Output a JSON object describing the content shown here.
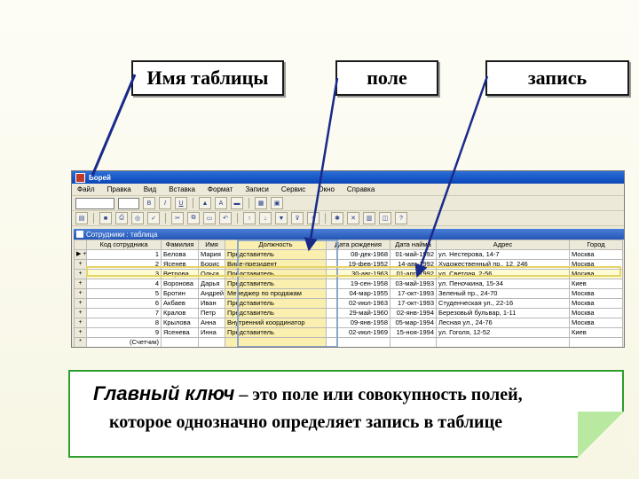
{
  "callouts": {
    "table_name": "Имя таблицы",
    "field": "поле",
    "record": "запись"
  },
  "window": {
    "title": "Борей",
    "menu": [
      "Файл",
      "Правка",
      "Вид",
      "Вставка",
      "Формат",
      "Записи",
      "Сервис",
      "Окно",
      "Справка"
    ],
    "font_select": "",
    "subwindow_title": "Сотрудники : таблица"
  },
  "table": {
    "columns": [
      "Код сотрудника",
      "Фамилия",
      "Имя",
      "Должность",
      "Дата рождения",
      "Дата найма",
      "Адрес",
      "Город"
    ],
    "rows": [
      {
        "sel": "▶ +",
        "id": "1",
        "last": "Белова",
        "first": "Мария",
        "pos": "Представитель",
        "birth": "08-дек-1968",
        "hire": "01-май-1992",
        "addr": "ул. Нестерова, 14-7",
        "city": "Москва"
      },
      {
        "sel": "+",
        "id": "2",
        "last": "Ясенев",
        "first": "Борис",
        "pos": "Вице-президент",
        "birth": "19-фев-1952",
        "hire": "14-авг-1992",
        "addr": "Художественный пр., 12, 246",
        "city": "Москва"
      },
      {
        "sel": "+",
        "id": "3",
        "last": "Ветрова",
        "first": "Ольга",
        "pos": "Представитель",
        "birth": "30-авг-1963",
        "hire": "01-апр-1992",
        "addr": "ул. Светлая, 2-56",
        "city": "Москва"
      },
      {
        "sel": "+",
        "id": "4",
        "last": "Воронова",
        "first": "Дарья",
        "pos": "Представитель",
        "birth": "19-сен-1958",
        "hire": "03-май-1993",
        "addr": "ул. Пеночкина, 15-34",
        "city": "Киев"
      },
      {
        "sel": "+",
        "id": "5",
        "last": "Бротин",
        "first": "Андрей",
        "pos": "Менеджер по продажам",
        "birth": "04-мар-1955",
        "hire": "17-окт-1993",
        "addr": "Зеленый пр., 24-70",
        "city": "Москва"
      },
      {
        "sel": "+",
        "id": "6",
        "last": "Акбаев",
        "first": "Иван",
        "pos": "Представитель",
        "birth": "02-июл-1963",
        "hire": "17-окт-1993",
        "addr": "Студенческая ул., 22-16",
        "city": "Москва"
      },
      {
        "sel": "+",
        "id": "7",
        "last": "Кралов",
        "first": "Петр",
        "pos": "Представитель",
        "birth": "29-май-1960",
        "hire": "02-янв-1994",
        "addr": "Березовый бульвар, 1-11",
        "city": "Москва"
      },
      {
        "sel": "+",
        "id": "8",
        "last": "Крылова",
        "first": "Анна",
        "pos": "Внутренний координатор",
        "birth": "09-янв-1958",
        "hire": "05-мар-1994",
        "addr": "Лесная ул., 24-76",
        "city": "Москва"
      },
      {
        "sel": "+",
        "id": "9",
        "last": "Ясенева",
        "first": "Инна",
        "pos": "Представитель",
        "birth": "02-июл-1969",
        "hire": "15-ноя-1994",
        "addr": "ул. Гоголя, 12-52",
        "city": "Киев"
      },
      {
        "sel": "*",
        "id": "(Счетчик)",
        "last": "",
        "first": "",
        "pos": "",
        "birth": "",
        "hire": "",
        "addr": "",
        "city": ""
      }
    ]
  },
  "definition": {
    "term": "Главный ключ",
    "dash": " – ",
    "line1_rest": "это поле или совокупность полей,",
    "line2": "которое однозначно определяет запись в таблице"
  },
  "colors": {
    "frame_green": "#2e9e2e",
    "field_highlight": "#fbefb0",
    "title_blue": "#0a45b8"
  }
}
